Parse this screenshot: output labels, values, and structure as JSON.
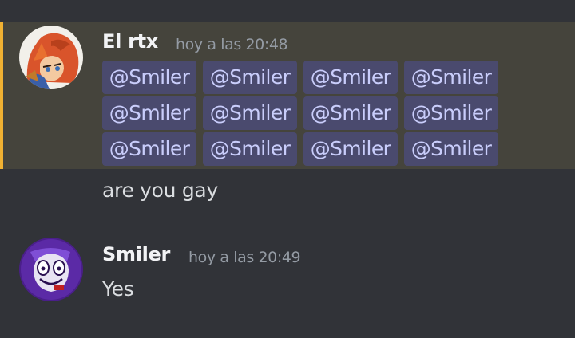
{
  "messages": [
    {
      "author": "El rtx",
      "timestamp": "hoy a las 20:48",
      "mentions": [
        "@Smiler",
        "@Smiler",
        "@Smiler",
        "@Smiler",
        "@Smiler",
        "@Smiler",
        "@Smiler",
        "@Smiler",
        "@Smiler",
        "@Smiler",
        "@Smiler",
        "@Smiler"
      ],
      "text": "are you gay",
      "highlight_color": "#f0b132",
      "avatar": "fox-character-avatar"
    },
    {
      "author": "Smiler",
      "timestamp": "hoy a las 20:49",
      "text": "Yes",
      "avatar": "smiling-face-avatar"
    }
  ],
  "colors": {
    "background": "#313338",
    "mentioned_background": "#45443c",
    "mention_pill": "#4a4a6e",
    "mention_text": "#c9cdfb"
  }
}
